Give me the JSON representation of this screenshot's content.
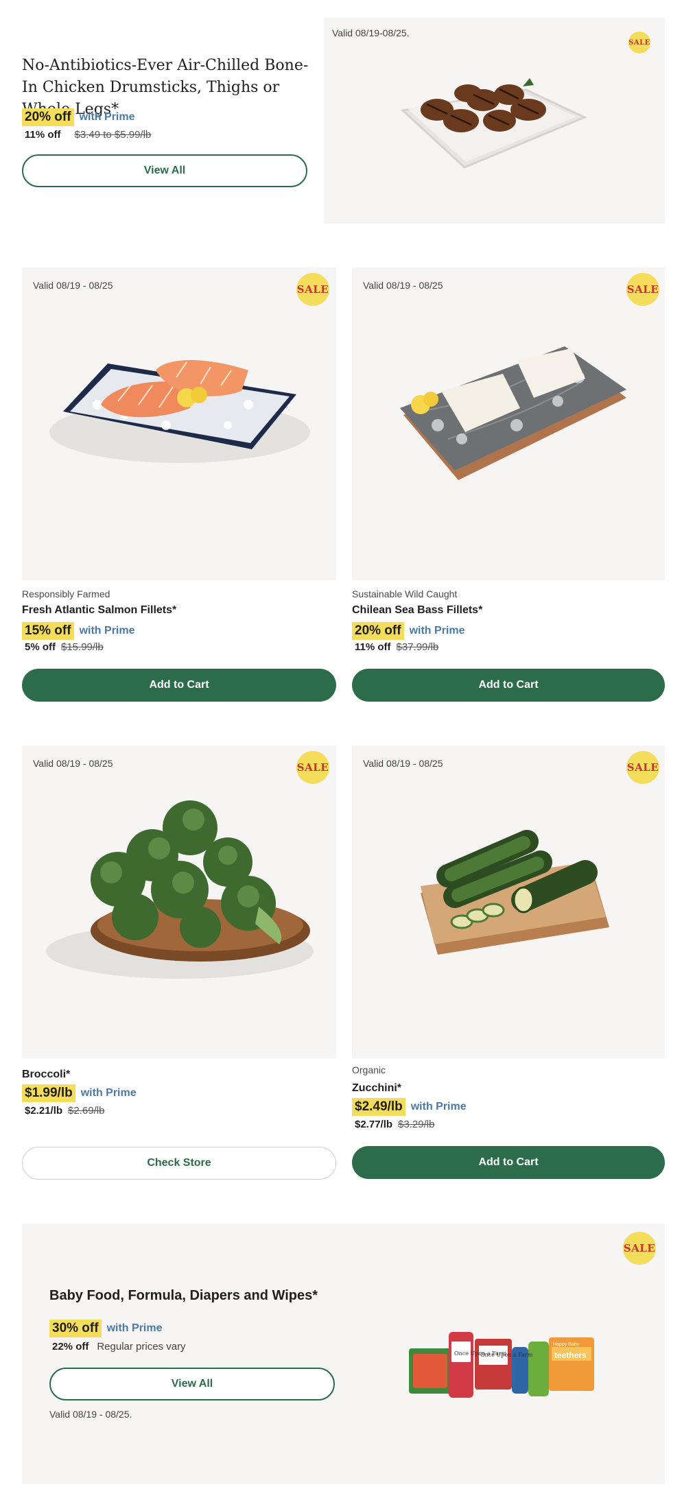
{
  "hero": {
    "title": "No-Antibiotics-Ever Air-Chilled Bone-In Chicken Drumsticks, Thighs or Whole Legs*",
    "discount": "20% off",
    "prime": "with Prime",
    "regular_discount": "11% off",
    "regular_price": "$3.49 to $5.99/lb",
    "button": "View All",
    "valid": "Valid 08/19-08/25.",
    "sale": "SALE",
    "image_icon": "grilled-chicken-platter-image"
  },
  "products": [
    {
      "valid": "Valid 08/19 - 08/25",
      "sale": "SALE",
      "tagline": "Responsibly Farmed",
      "name": "Fresh Atlantic Salmon Fillets*",
      "discount": "15% off",
      "prime": "with Prime",
      "regular_discount": "5% off",
      "regular_price": "$15.99/lb",
      "button": "Add to Cart",
      "image_icon": "salmon-on-ice-image"
    },
    {
      "valid": "Valid 08/19 - 08/25",
      "sale": "SALE",
      "tagline": "Sustainable Wild Caught",
      "name": "Chilean Sea Bass Fillets*",
      "discount": "20% off",
      "prime": "with Prime",
      "regular_discount": "11% off",
      "regular_price": "$37.99/lb",
      "button": "Add to Cart",
      "image_icon": "sea-bass-on-marble-image"
    },
    {
      "valid": "Valid 08/19 - 08/25",
      "sale": "SALE",
      "tagline": "",
      "name": "Broccoli*",
      "discount": "$1.99/lb",
      "prime": "with Prime",
      "regular_discount": "$2.21/lb",
      "regular_price": "$2.69/lb",
      "button": "Check Store",
      "image_icon": "broccoli-plate-image"
    },
    {
      "valid": "Valid 08/19 - 08/25",
      "sale": "SALE",
      "tagline": "Organic",
      "name": "Zucchini*",
      "discount": "$2.49/lb",
      "prime": "with Prime",
      "regular_discount": "$2.77/lb",
      "regular_price": "$3.29/lb",
      "button": "Add to Cart",
      "image_icon": "zucchini-board-image"
    }
  ],
  "baby": {
    "title": "Baby Food, Formula, Diapers and Wipes*",
    "discount": "30% off",
    "prime": "with Prime",
    "regular_discount": "22% off",
    "regular_note": "Regular prices vary",
    "button": "View All",
    "valid": "Valid 08/19 - 08/25.",
    "sale": "SALE",
    "image_icon": "baby-food-pouches-image",
    "pouch_labels": [
      "Once Upon a Farm",
      "Once Upon a Farm",
      "Happy Baby",
      "teethers"
    ]
  },
  "colors": {
    "accent_green": "#2d6c4a",
    "sale_yellow": "#f5dd5c",
    "sale_red": "#c8342f",
    "prime_blue": "#4c7aa4",
    "panel_bg": "#f6f5f3"
  }
}
